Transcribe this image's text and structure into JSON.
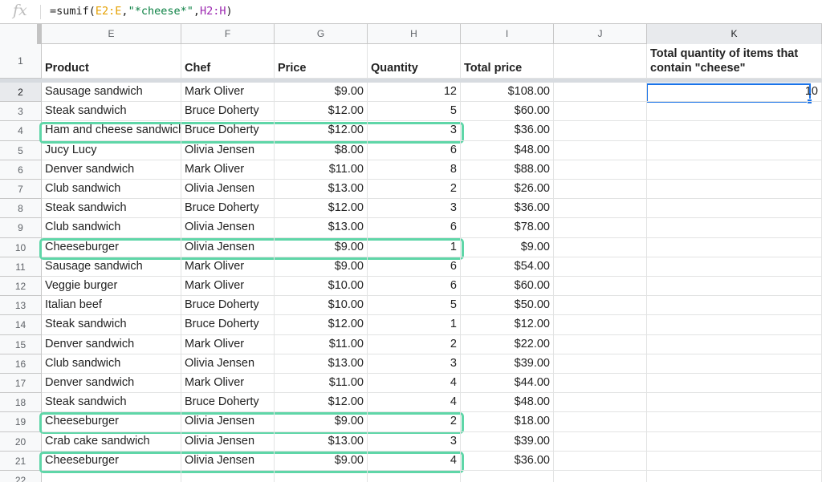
{
  "formula_bar": {
    "fx_label": "fx",
    "formula_start": "=sumif(",
    "range1": "E2:E",
    "comma1": ",",
    "criteria": "\"*cheese*\"",
    "comma2": ",",
    "range2": "H2:H",
    "formula_end": ")"
  },
  "columns": [
    "E",
    "F",
    "G",
    "H",
    "I",
    "J",
    "K"
  ],
  "row_numbers": [
    "1",
    "2",
    "3",
    "4",
    "5",
    "6",
    "7",
    "8",
    "9",
    "10",
    "11",
    "12",
    "13",
    "14",
    "15",
    "16",
    "17",
    "18",
    "19",
    "20",
    "21",
    "22"
  ],
  "headers": {
    "product": "Product",
    "chef": "Chef",
    "price": "Price",
    "quantity": "Quantity",
    "total_price": "Total price",
    "summary_label": "Total quantity of items that contain \"cheese\""
  },
  "summary_value": "10",
  "rows": [
    {
      "product": "Sausage sandwich",
      "chef": "Mark Oliver",
      "price": "$9.00",
      "quantity": "12",
      "total": "$108.00"
    },
    {
      "product": "Steak sandwich",
      "chef": "Bruce Doherty",
      "price": "$12.00",
      "quantity": "5",
      "total": "$60.00"
    },
    {
      "product": "Ham and cheese sandwich",
      "chef": "Bruce Doherty",
      "price": "$12.00",
      "quantity": "3",
      "total": "$36.00"
    },
    {
      "product": "Jucy Lucy",
      "chef": "Olivia Jensen",
      "price": "$8.00",
      "quantity": "6",
      "total": "$48.00"
    },
    {
      "product": "Denver sandwich",
      "chef": "Mark Oliver",
      "price": "$11.00",
      "quantity": "8",
      "total": "$88.00"
    },
    {
      "product": "Club sandwich",
      "chef": "Olivia Jensen",
      "price": "$13.00",
      "quantity": "2",
      "total": "$26.00"
    },
    {
      "product": "Steak sandwich",
      "chef": "Bruce Doherty",
      "price": "$12.00",
      "quantity": "3",
      "total": "$36.00"
    },
    {
      "product": "Club sandwich",
      "chef": "Olivia Jensen",
      "price": "$13.00",
      "quantity": "6",
      "total": "$78.00"
    },
    {
      "product": "Cheeseburger",
      "chef": "Olivia Jensen",
      "price": "$9.00",
      "quantity": "1",
      "total": "$9.00"
    },
    {
      "product": "Sausage sandwich",
      "chef": "Mark Oliver",
      "price": "$9.00",
      "quantity": "6",
      "total": "$54.00"
    },
    {
      "product": "Veggie burger",
      "chef": "Mark Oliver",
      "price": "$10.00",
      "quantity": "6",
      "total": "$60.00"
    },
    {
      "product": "Italian beef",
      "chef": "Bruce Doherty",
      "price": "$10.00",
      "quantity": "5",
      "total": "$50.00"
    },
    {
      "product": "Steak sandwich",
      "chef": "Bruce Doherty",
      "price": "$12.00",
      "quantity": "1",
      "total": "$12.00"
    },
    {
      "product": "Denver sandwich",
      "chef": "Mark Oliver",
      "price": "$11.00",
      "quantity": "2",
      "total": "$22.00"
    },
    {
      "product": "Club sandwich",
      "chef": "Olivia Jensen",
      "price": "$13.00",
      "quantity": "3",
      "total": "$39.00"
    },
    {
      "product": "Denver sandwich",
      "chef": "Mark Oliver",
      "price": "$11.00",
      "quantity": "4",
      "total": "$44.00"
    },
    {
      "product": "Steak sandwich",
      "chef": "Bruce Doherty",
      "price": "$12.00",
      "quantity": "4",
      "total": "$48.00"
    },
    {
      "product": "Cheeseburger",
      "chef": "Olivia Jensen",
      "price": "$9.00",
      "quantity": "2",
      "total": "$18.00"
    },
    {
      "product": "Crab cake sandwich",
      "chef": "Olivia Jensen",
      "price": "$13.00",
      "quantity": "3",
      "total": "$39.00"
    },
    {
      "product": "Cheeseburger",
      "chef": "Olivia Jensen",
      "price": "$9.00",
      "quantity": "4",
      "total": "$36.00"
    }
  ],
  "highlight_color": "#5fd6a8",
  "selection_color": "#1a73e8"
}
